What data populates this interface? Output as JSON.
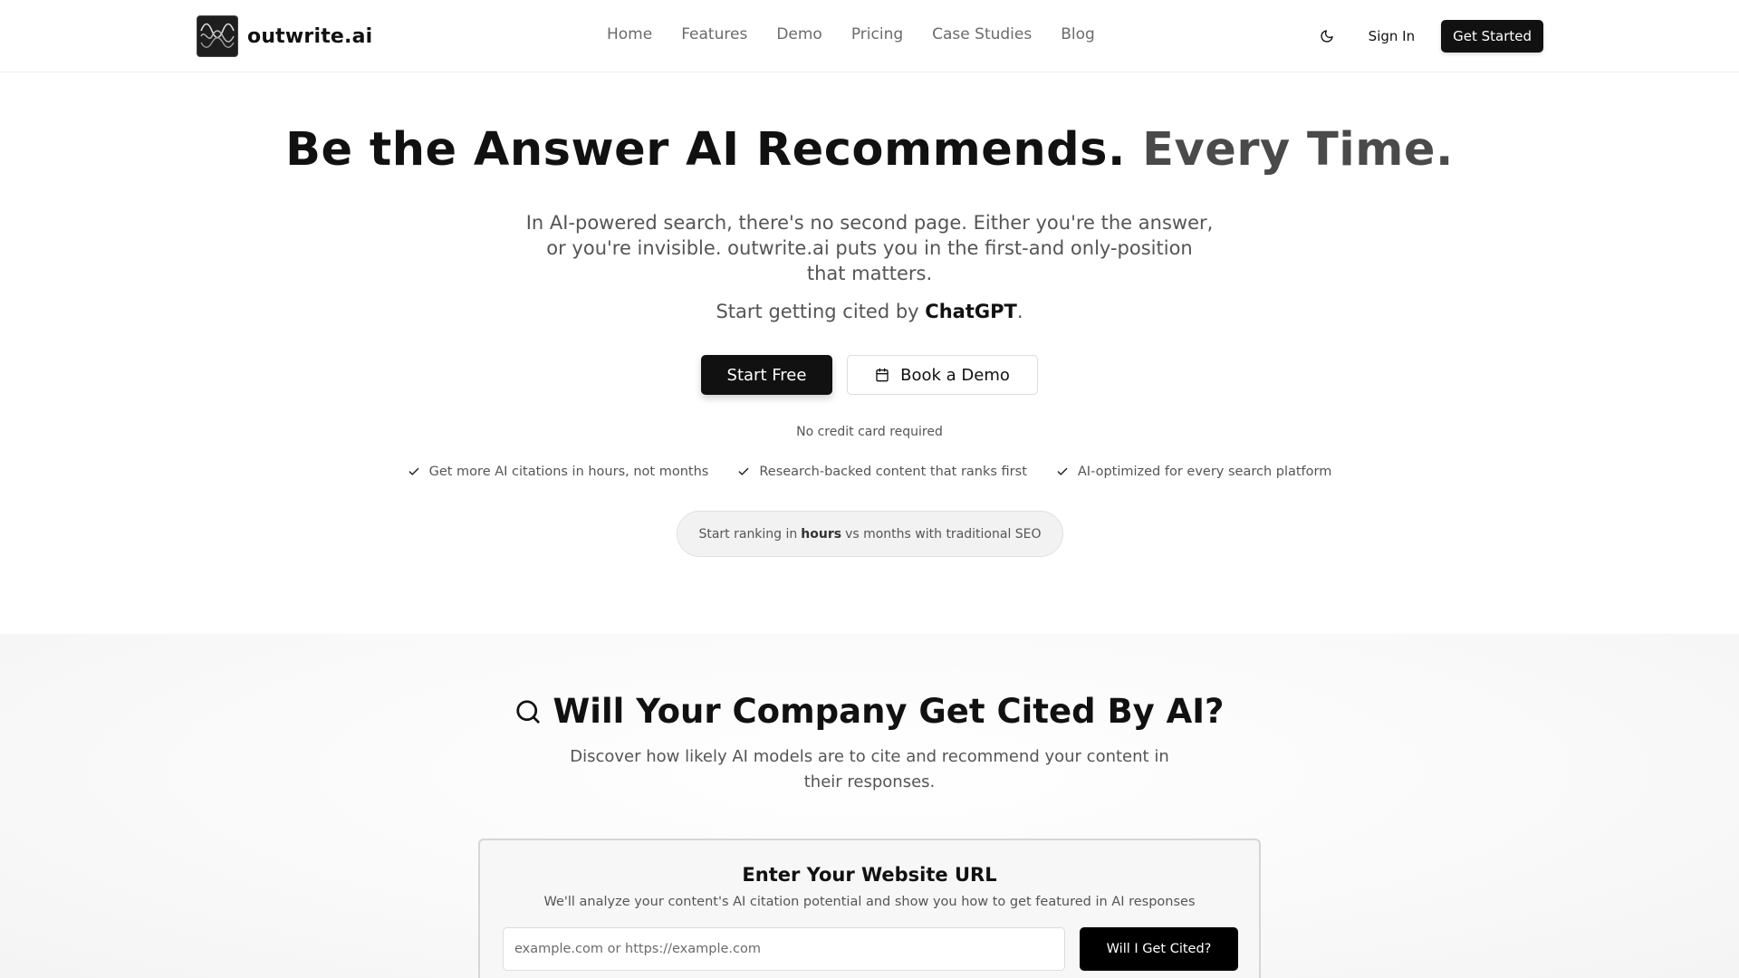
{
  "brand": {
    "name": "outwrite.ai",
    "logo_icon": "waveform-logo-icon"
  },
  "nav": {
    "links": [
      "Home",
      "Features",
      "Demo",
      "Pricing",
      "Case Studies",
      "Blog"
    ],
    "theme_icon": "moon-icon",
    "sign_in": "Sign In",
    "get_started": "Get Started"
  },
  "hero": {
    "title_main": "Be the Answer AI Recommends.",
    "title_muted": "Every Time.",
    "subtitle": "In AI-powered search, there's no second page. Either you're the answer, or you're invisible. outwrite.ai puts you in the first-and only-position that matters.",
    "cited_prefix": "Start getting cited by",
    "cited_name": "ChatGPT",
    "cited_suffix": ".",
    "start_free": "Start Free",
    "book_demo": "Book a Demo",
    "book_demo_icon": "calendar-icon",
    "no_card": "No credit card required",
    "features": [
      "Get more AI citations in hours, not months",
      "Research-backed content that ranks first",
      "AI-optimized for every search platform"
    ],
    "feature_icon": "check-icon",
    "pill_prefix": "Start ranking in",
    "pill_bold": "hours",
    "pill_suffix": "vs months with traditional SEO"
  },
  "section": {
    "title": "Will Your Company Get Cited By AI?",
    "title_icon": "search-icon",
    "subtitle": "Discover how likely AI models are to cite and recommend your content in their responses."
  },
  "card": {
    "title": "Enter Your Website URL",
    "subtitle": "We'll analyze your content's AI citation potential and show you how to get featured in AI responses",
    "input_placeholder": "example.com or https://example.com",
    "input_value": "",
    "button": "Will I Get Cited?"
  }
}
